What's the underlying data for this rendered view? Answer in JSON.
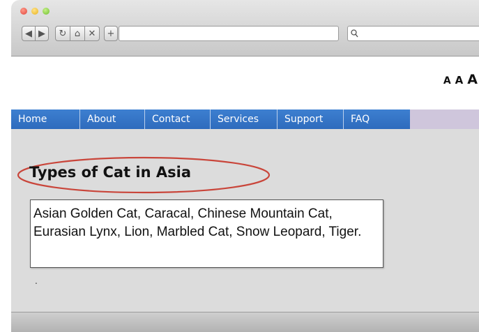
{
  "browser": {
    "toolbar": {
      "back_icon": "◀",
      "forward_icon": "▶",
      "reload_icon": "↻",
      "home_icon": "⌂",
      "stop_icon": "✕",
      "new_tab_icon": "+",
      "search_icon": "⚲"
    },
    "address_bar": {
      "value": ""
    },
    "search_bar": {
      "value": ""
    }
  },
  "page": {
    "text_size_controls": [
      "A",
      "A",
      "A"
    ],
    "menu": [
      "Home",
      "About",
      "Contact",
      "Services",
      "Support",
      "FAQ"
    ],
    "heading": "Types of Cat in Asia",
    "description": "Asian Golden Cat, Caracal, Chinese Mountain Cat, Eurasian Lynx, Lion, Marbled Cat, Snow Leopard, Tiger.",
    "stray_mark": "."
  },
  "colors": {
    "menu_bg": "#2e6bbd",
    "highlight_ellipse": "#c9453a",
    "content_bg": "#dcdcdc"
  }
}
